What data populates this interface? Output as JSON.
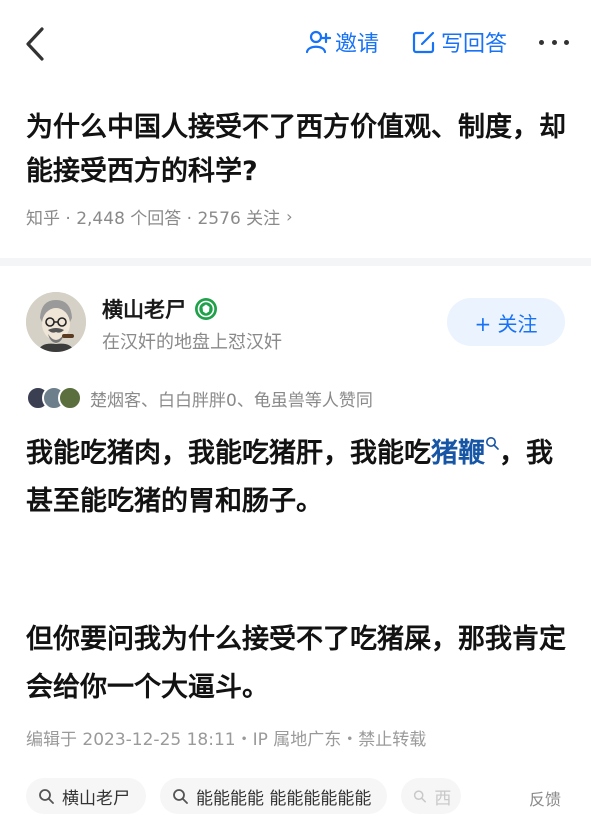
{
  "topbar": {
    "invite_label": "邀请",
    "write_answer_label": "写回答"
  },
  "question": {
    "title": "为什么中国人接受不了西方价值观、制度，却能接受西方的科学?",
    "meta": "知乎 · 2,448 个回答 · 2576 关注",
    "meta_arrow": "›"
  },
  "author": {
    "name": "横山老尸",
    "bio": "在汉奸的地盘上怼汉奸",
    "follow_label": "+ 关注"
  },
  "upvoters": {
    "text": "楚烟客、白白胖胖0、龟虽兽等人赞同",
    "avatar_colors": [
      "#3a3f52",
      "#6e7f8c",
      "#5a6e3e"
    ]
  },
  "answer": {
    "p1_before": "我能吃猪肉，我能吃猪肝，我能吃",
    "p1_link": "猪鞭",
    "p1_after": "，我甚至能吃猪的胃和肠子。",
    "p2": "但你要问我为什么接受不了吃猪屎，那我肯定会给你一个大逼斗。"
  },
  "edit_meta": "编辑于 2023-12-25 18:11・IP 属地广东・禁止转载",
  "tags": [
    {
      "label": "横山老尸"
    },
    {
      "label": "能能能能 能能能能能能"
    },
    {
      "label": "西"
    }
  ],
  "feedback_label": "反馈",
  "colors": {
    "accent": "#1772f6",
    "link": "#1755a5",
    "follow_bg": "#ebf3fe",
    "verify_green": "#1fa14a"
  },
  "icons": {
    "back": "chevron-left-icon",
    "invite": "add-user-icon",
    "write": "edit-icon",
    "more": "more-icon",
    "verify": "verified-badge-icon",
    "search": "search-icon"
  }
}
